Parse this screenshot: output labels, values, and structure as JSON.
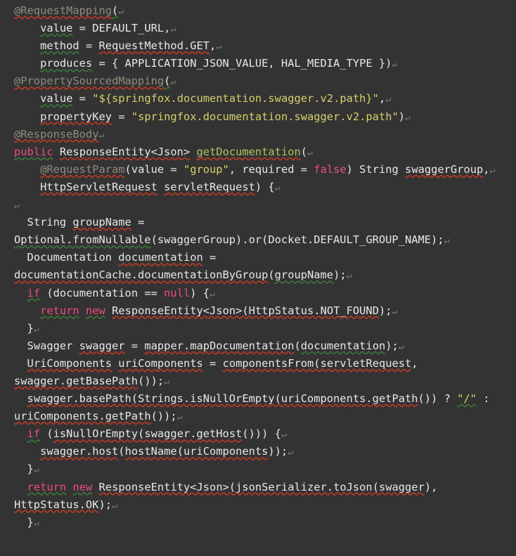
{
  "editor": {
    "name": "java-code-editor",
    "theme": "dark",
    "background_color": "#333333",
    "language": "Java",
    "paragraph_mark": "↵",
    "colors": {
      "background": "#333333",
      "plain_text": "#E8E8E8",
      "annotation": "#908B7E",
      "keyword": "#EE4C7E",
      "string": "#D6D16E",
      "function": "#B2C35E",
      "paragraph_mark": "#7C7C7C",
      "spellcheck_underline": "#C63A22",
      "inspection_underline": "#3E7A3A"
    }
  },
  "code_lines": [
    {
      "id": 1,
      "text": "@RequestMapping("
    },
    {
      "id": 2,
      "text": "    value = DEFAULT_URL,"
    },
    {
      "id": 3,
      "text": "    method = RequestMethod.GET,"
    },
    {
      "id": 4,
      "text": "    produces = { APPLICATION_JSON_VALUE, HAL_MEDIA_TYPE })"
    },
    {
      "id": 5,
      "text": "@PropertySourcedMapping("
    },
    {
      "id": 6,
      "text": "    value = \"${springfox.documentation.swagger.v2.path}\","
    },
    {
      "id": 7,
      "text": "    propertyKey = \"springfox.documentation.swagger.v2.path\")"
    },
    {
      "id": 8,
      "text": "@ResponseBody"
    },
    {
      "id": 9,
      "text": "public ResponseEntity<Json> getDocumentation("
    },
    {
      "id": 10,
      "text": "    @RequestParam(value = \"group\", required = false) String swaggerGroup,"
    },
    {
      "id": 11,
      "text": "    HttpServletRequest servletRequest) {"
    },
    {
      "id": 12,
      "text": ""
    },
    {
      "id": 13,
      "text": "  String groupName ="
    },
    {
      "id": 14,
      "text": "Optional.fromNullable(swaggerGroup).or(Docket.DEFAULT_GROUP_NAME);"
    },
    {
      "id": 15,
      "text": "  Documentation documentation ="
    },
    {
      "id": 16,
      "text": "documentationCache.documentationByGroup(groupName);"
    },
    {
      "id": 17,
      "text": "  if (documentation == null) {"
    },
    {
      "id": 18,
      "text": "    return new ResponseEntity<Json>(HttpStatus.NOT_FOUND);"
    },
    {
      "id": 19,
      "text": "  }"
    },
    {
      "id": 20,
      "text": "  Swagger swagger = mapper.mapDocumentation(documentation);"
    },
    {
      "id": 21,
      "text": "  UriComponents uriComponents = componentsFrom(servletRequest,"
    },
    {
      "id": 22,
      "text": "swagger.getBasePath());"
    },
    {
      "id": 23,
      "text": "  swagger.basePath(Strings.isNullOrEmpty(uriComponents.getPath()) ? \"/\" :"
    },
    {
      "id": 24,
      "text": "uriComponents.getPath());"
    },
    {
      "id": 25,
      "text": "  if (isNullOrEmpty(swagger.getHost())) {"
    },
    {
      "id": 26,
      "text": "    swagger.host(hostName(uriComponents));"
    },
    {
      "id": 27,
      "text": "  }"
    },
    {
      "id": 28,
      "text": "  return new ResponseEntity<Json>(jsonSerializer.toJson(swagger),"
    },
    {
      "id": 29,
      "text": "HttpStatus.OK);"
    },
    {
      "id": 30,
      "text": "}"
    }
  ],
  "identifiers": {
    "annotations": [
      "@RequestMapping",
      "@PropertySourcedMapping",
      "@ResponseBody",
      "@RequestParam"
    ],
    "keywords": [
      "public",
      "false",
      "if",
      "null",
      "return",
      "new"
    ],
    "strings": [
      "\"${springfox.documentation.swagger.v2.path}\"",
      "\"springfox.documentation.swagger.v2.path\"",
      "\"group\"",
      "\"/\""
    ],
    "functions": [
      "getDocumentation",
      "mapDocumentation",
      "componentsFrom"
    ],
    "types": [
      "ResponseEntity",
      "Json",
      "String",
      "HttpServletRequest",
      "Documentation",
      "Swagger",
      "UriComponents",
      "Optional",
      "Docket",
      "HttpStatus",
      "Strings",
      "RequestMethod"
    ],
    "variables": [
      "value",
      "method",
      "produces",
      "propertyKey",
      "swaggerGroup",
      "servletRequest",
      "groupName",
      "documentation",
      "swagger",
      "uriComponents",
      "documentationCache",
      "mapper",
      "jsonSerializer",
      "required"
    ],
    "constants": [
      "DEFAULT_URL",
      "APPLICATION_JSON_VALUE",
      "HAL_MEDIA_TYPE",
      "GET",
      "DEFAULT_GROUP_NAME",
      "NOT_FOUND",
      "OK"
    ],
    "calls": [
      "fromNullable",
      "or",
      "documentationByGroup",
      "getBasePath",
      "basePath",
      "isNullOrEmpty",
      "getPath",
      "getHost",
      "host",
      "hostName",
      "toJson"
    ]
  }
}
